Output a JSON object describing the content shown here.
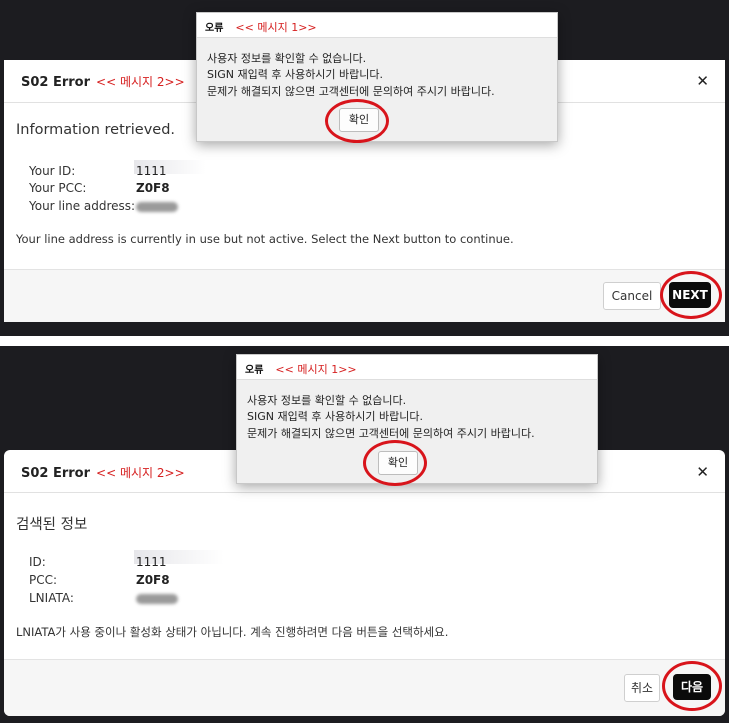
{
  "english": {
    "title": "S02 Error",
    "note": "<< 메시지 2>>",
    "heading": "Information retrieved.",
    "fields": [
      {
        "label": "Your ID:",
        "value": "1111"
      },
      {
        "label": "Your PCC:",
        "value": "Z0F8"
      },
      {
        "label": "Your line address:",
        "value": ""
      }
    ],
    "body": "Your line address is currently in use but not active. Select the Next button to continue.",
    "cancel": "Cancel",
    "next": "NEXT",
    "popup": {
      "title": "오류",
      "note": "<< 메시지 1>>",
      "lines": [
        "사용자 정보를 확인할 수 없습니다.",
        "SIGN 재입력 후 사용하시기 바랍니다.",
        "문제가 해결되지 않으면 고객센터에 문의하여 주시기 바랍니다."
      ],
      "ok": "확인"
    }
  },
  "korean": {
    "title": "S02 Error",
    "note": "<< 메시지 2>>",
    "heading": "검색된 정보",
    "fields": [
      {
        "label": "ID:",
        "value": "1111"
      },
      {
        "label": "PCC:",
        "value": "Z0F8"
      },
      {
        "label": "LNIATA:",
        "value": ""
      }
    ],
    "body": "LNIATA가 사용 중이나 활성화 상태가 아닙니다. 계속 진행하려면 다음 버튼을 선택하세요.",
    "cancel": "취소",
    "next": "다음",
    "popup": {
      "title": "오류",
      "note": "<< 메시지 1>>",
      "lines": [
        "사용자 정보를 확인할 수 없습니다.",
        "SIGN 재입력 후 사용하시기 바랍니다.",
        "문제가 해결되지 않으면 고객센터에 문의하여 주시기 바랍니다."
      ],
      "ok": "확인"
    }
  },
  "icons": {
    "close": "close-icon"
  },
  "colors": {
    "annotation_red": "#d8141b",
    "next_button": "#0b0b0b"
  }
}
